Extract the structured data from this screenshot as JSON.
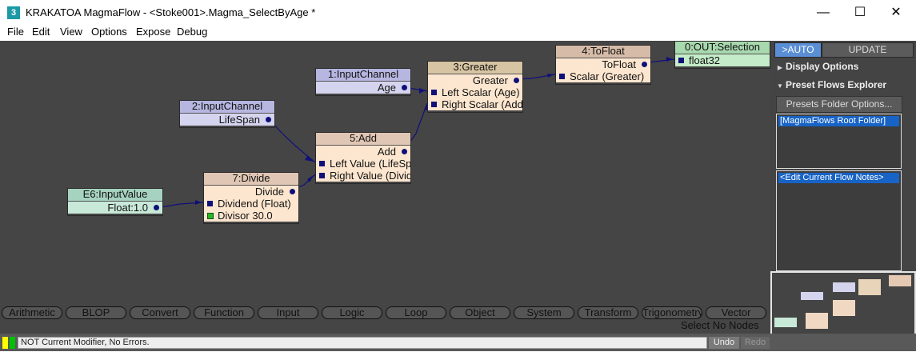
{
  "window": {
    "app_name": "KRAKATOA MagmaFlow",
    "title": "KRAKATOA MagmaFlow - <Stoke001>.Magma_SelectByAge *",
    "app_icon_glyph": "3",
    "minimize_glyph": "—",
    "maximize_glyph": "☐",
    "close_glyph": "✕"
  },
  "menu": [
    "File",
    "Edit",
    "View",
    "Options",
    "Expose",
    "Debug"
  ],
  "nodes": {
    "out": {
      "title": "0:OUT:Selection",
      "rows": [
        "float32"
      ],
      "color": "#c4ecc8"
    },
    "input_channel_age": {
      "title": "1:InputChannel",
      "rows": [
        "Age"
      ],
      "color": "#d4d4ee",
      "head_color": "#b6b6e0"
    },
    "input_channel_lifespan": {
      "title": "2:InputChannel",
      "rows": [
        "LifeSpan"
      ],
      "color": "#d4d4ee",
      "head_color": "#b6b6e0"
    },
    "greater": {
      "title": "3:Greater",
      "rows": [
        "Greater",
        "Left Scalar (Age)",
        "Right Scalar (Add)"
      ],
      "color": "#fde6cf",
      "head_color": "#d6c4a2"
    },
    "to_float": {
      "title": "4:ToFloat",
      "rows": [
        "ToFloat",
        "Scalar (Greater)"
      ],
      "color": "#fde6cf",
      "head_color": "#d6bca8"
    },
    "add": {
      "title": "5:Add",
      "rows": [
        "Add",
        "Left Value (LifeSpan)",
        "Right Value (Divide)"
      ],
      "color": "#fde6cf",
      "head_color": "#e0c6b4"
    },
    "divide": {
      "title": "7:Divide",
      "rows": [
        "Divide",
        "Dividend (Float)",
        "Divisor 30.0"
      ],
      "color": "#fde6cf",
      "head_color": "#e0c6b4"
    },
    "input_value": {
      "title": "E6:InputValue",
      "rows": [
        "Float:1.0"
      ],
      "color": "#c8e8d8",
      "head_color": "#a6d2c0"
    }
  },
  "categories": [
    "Arithmetic",
    "BLOP",
    "Convert",
    "Function",
    "Input",
    "Logic",
    "Loop",
    "Object",
    "System",
    "Transform",
    "Trigonometry",
    "Vector"
  ],
  "selection_status": "Select No Nodes",
  "side_panel": {
    "auto_button": ">AUTO",
    "update_button": "UPDATE",
    "display_options": "Display Options",
    "preset_flows_explorer": "Preset Flows Explorer",
    "presets_folder_button": "Presets Folder Options...",
    "root_folder_item": "[MagmaFlows Root Folder]",
    "edit_notes_item": "<Edit Current Flow Notes>",
    "accent_color": "#5a8fd6"
  },
  "status_bar": {
    "message": "NOT Current Modifier, No Errors.",
    "undo_label": "Undo",
    "redo_label": "Redo",
    "light_colors": [
      "#ffff00",
      "#00c000"
    ]
  },
  "colors": {
    "canvas_bg": "#454545",
    "wire": "#10107a",
    "selection": "#1763c6"
  }
}
